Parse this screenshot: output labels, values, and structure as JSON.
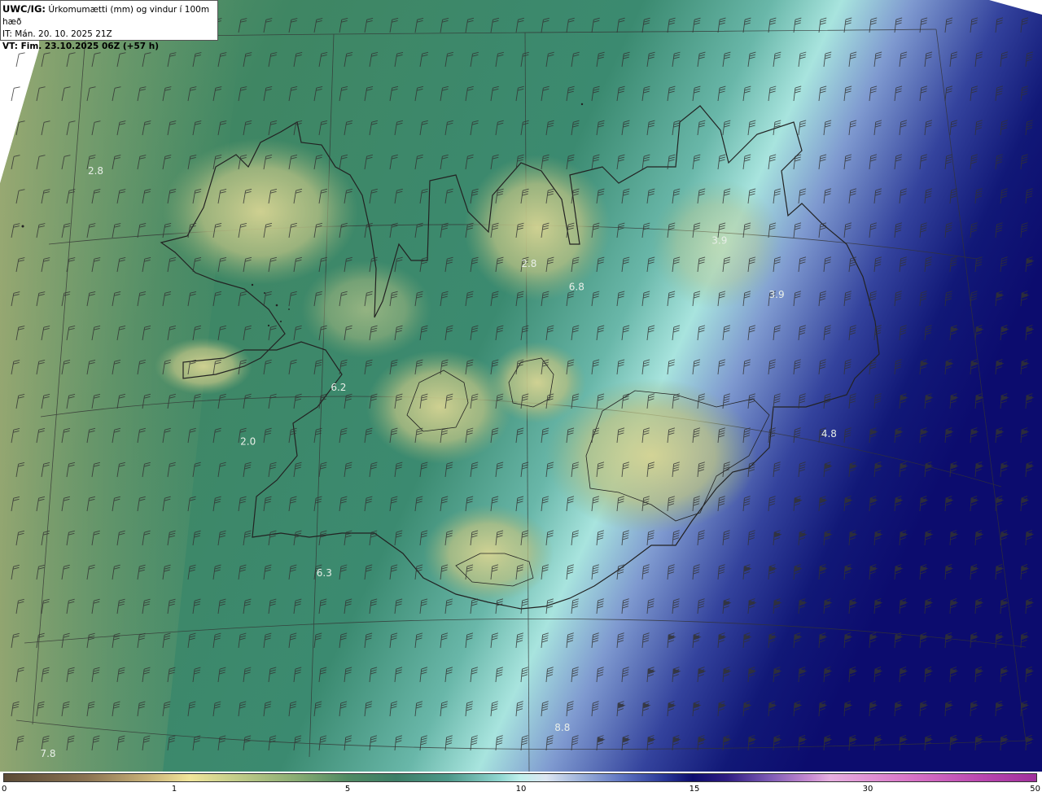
{
  "header": {
    "model": "UWC/IG:",
    "parameter": "Úrkomumætti (mm) og vindur í 100m hæð",
    "issue_time": "IT: Mán. 20. 10. 2025 21Z",
    "valid_time": "VT: Fim. 23.10.2025 06Z (+57 h)"
  },
  "map_labels": [
    {
      "text": "2.8",
      "lon": -26.0,
      "lat": 66.4
    },
    {
      "text": "6.2",
      "lon": -20.9,
      "lat": 65.0
    },
    {
      "text": "2.8",
      "lon": -16.9,
      "lat": 65.8
    },
    {
      "text": "6.8",
      "lon": -15.9,
      "lat": 65.65
    },
    {
      "text": "3.9",
      "lon": -12.9,
      "lat": 65.95
    },
    {
      "text": "3.9",
      "lon": -11.7,
      "lat": 65.6
    },
    {
      "text": "4.8",
      "lon": -10.6,
      "lat": 64.7
    },
    {
      "text": "2.0",
      "lon": -22.8,
      "lat": 64.65
    },
    {
      "text": "6.3",
      "lon": -21.2,
      "lat": 63.8
    },
    {
      "text": "8.8",
      "lon": -16.2,
      "lat": 62.8
    },
    {
      "text": "7.8",
      "lon": -27.0,
      "lat": 61.2
    }
  ],
  "colorbar": {
    "ticks": [
      "0",
      "1",
      "5",
      "10",
      "15",
      "30",
      "50"
    ],
    "units": "mm"
  },
  "colors": {
    "lowland": "#5a9a6a",
    "highland": "#c4c98a",
    "heavy": "#0c0c6e",
    "coastline": "#222222"
  },
  "wind": {
    "direction_deg": 200,
    "unit": "kt"
  }
}
